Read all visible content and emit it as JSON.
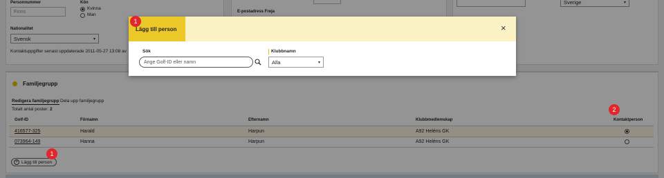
{
  "personal": {
    "personnummer_label": "Personnummer",
    "personnummer_placeholder": "Finns",
    "gender_label": "Kön",
    "gender_options": [
      "Kvinna",
      "Man"
    ],
    "nationality_label": "Nationalitet",
    "nationality_value": "Svensk",
    "updated_text": "Kontaktuppgifter senast uppdaterade 2011-05-27 13:08 av",
    "epost_label": "E-postadress Freja"
  },
  "address": {
    "country_value": "Sverige"
  },
  "family": {
    "title": "Familjegrupp",
    "tabs": [
      "Redigera familjegrupp",
      "Dela upp familjegrupp"
    ],
    "total_label": "Totalt antal poster:",
    "total_value": "2",
    "columns": [
      "Golf-ID",
      "Förnamn",
      "Efternamn",
      "Klubbmedlemskap",
      "Kontaktperson"
    ],
    "rows": [
      {
        "golf_id": "416577-325",
        "first": "Harald",
        "last": "Harpun",
        "club": "A92 Heléns GK",
        "contact": true
      },
      {
        "golf_id": "073964-149",
        "first": "Hanna",
        "last": "Harpun",
        "club": "A92 Heléns GK",
        "contact": false
      }
    ],
    "add_person_label": "Lägg till person"
  },
  "modal": {
    "title": "Lägg till person",
    "close_icon": "close-icon",
    "search_label": "Sök",
    "search_placeholder": "Ange Golf-ID eller namn",
    "club_label": "Klubbnamn",
    "club_value": "Alla"
  },
  "badges": {
    "modal_badge": "1",
    "add_badge": "1",
    "contact_badge": "2"
  },
  "colors": {
    "accent_yellow": "#ecc928",
    "modal_header_bg": "#fbf3c6",
    "badge_red": "#e1262d"
  }
}
